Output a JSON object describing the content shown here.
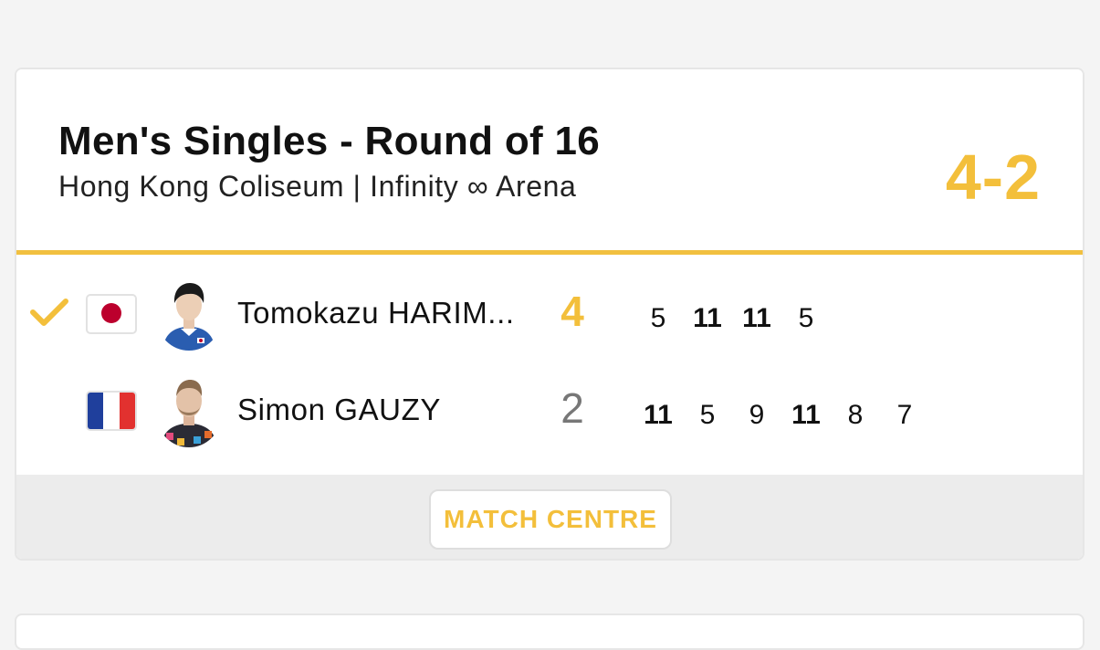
{
  "match": {
    "title": "Men's Singles - Round of 16",
    "venue": "Hong Kong Coliseum | Infinity ∞ Arena",
    "overall_score": "4-2",
    "accent_color": "#f3bf3b"
  },
  "players": [
    {
      "name": "Tomokazu HARIM...",
      "country_flag": "japan-flag",
      "sets_won": "4",
      "winner": true,
      "games": [
        "5",
        "11",
        "11",
        "5"
      ]
    },
    {
      "name": "Simon GAUZY",
      "country_flag": "france-flag",
      "sets_won": "2",
      "winner": false,
      "games": [
        "11",
        "5",
        "9",
        "11",
        "8",
        "7"
      ]
    }
  ],
  "footer": {
    "match_centre_label": "MATCH CENTRE"
  }
}
